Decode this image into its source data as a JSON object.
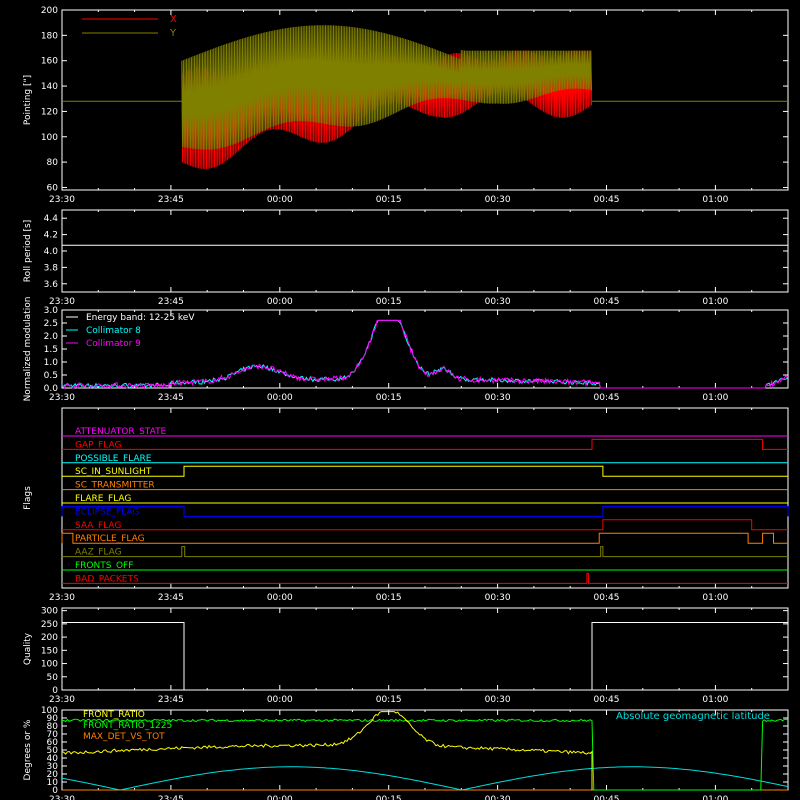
{
  "colors": {
    "background": "#000000",
    "axes": "#ffffff",
    "red": "#ff0000",
    "olive": "#808000",
    "cyan": "#00ffff",
    "magenta": "#ff00ff",
    "white": "#ffffff",
    "yellow": "#ffff00",
    "green": "#00ff00",
    "orange": "#ff8000",
    "blue": "#0000ff",
    "aqua": "#00ffdd"
  },
  "time_ticks": [
    "23:30",
    "23:45",
    "00:00",
    "00:15",
    "00:30",
    "00:45",
    "01:00"
  ],
  "chart_data": [
    {
      "type": "line",
      "name": "pointing",
      "ylabel": "Pointing [\"]",
      "ylim": [
        58,
        200
      ],
      "yticks": [
        "60",
        "80",
        "100",
        "120",
        "140",
        "160",
        "180",
        "200"
      ],
      "xlim_minutes_from_2330": [
        0,
        100
      ],
      "series": [
        {
          "name": "X",
          "color": "#ff0000",
          "t_start": 16.5,
          "t_end": 73,
          "min": 72,
          "max": 168,
          "outside_value": 128
        },
        {
          "name": "Y",
          "color": "#808000",
          "t_start": 16.5,
          "t_end": 73,
          "min": 92,
          "max": 188,
          "outside_value": 128
        }
      ],
      "legend": [
        "X",
        "Y"
      ]
    },
    {
      "type": "line",
      "name": "roll-period",
      "ylabel": "Roll period [s]",
      "ylim": [
        3.5,
        4.5
      ],
      "yticks": [
        "3.6",
        "3.8",
        "4.0",
        "4.2",
        "4.4"
      ],
      "series": [
        {
          "name": "Roll period",
          "color": "#ffffff",
          "value": 4.07
        }
      ]
    },
    {
      "type": "line",
      "name": "modulation",
      "ylabel": "Normalized modulation",
      "ylim": [
        0,
        3
      ],
      "yticks": [
        "0.0",
        "0.5",
        "1.0",
        "1.5",
        "2.0",
        "2.5",
        "3.0"
      ],
      "annotation": "Energy band: 12-25 keV",
      "legend": [
        "Collimator 8",
        "Collimator 9"
      ],
      "series": [
        {
          "name": "Collimator 8",
          "color": "#00ffff",
          "peak_time": 45,
          "peak_value": 2.6
        },
        {
          "name": "Collimator 9",
          "color": "#ff00ff",
          "peak_time": 45,
          "peak_value": 2.6
        }
      ]
    },
    {
      "type": "line",
      "name": "flags",
      "ylabel": "Flags",
      "flags": [
        {
          "label": "ATTENUATOR_STATE",
          "color": "#ff00ff",
          "high_intervals": []
        },
        {
          "label": "GAP_FLAG",
          "color": "#ff0000",
          "high_intervals": [
            [
              73,
              96.5
            ]
          ]
        },
        {
          "label": "POSSIBLE_FLARE",
          "color": "#00ffff",
          "high_intervals": []
        },
        {
          "label": "SC_IN_SUNLIGHT",
          "color": "#ffff00",
          "high_intervals": [
            [
              16.8,
              74.5
            ]
          ]
        },
        {
          "label": "SC_TRANSMITTER",
          "color": "#ff8000",
          "high_intervals": []
        },
        {
          "label": "FLARE_FLAG",
          "color": "#ffff00",
          "high_intervals": []
        },
        {
          "label": "ECLIPSE_FLAG",
          "color": "#0000ff",
          "high_intervals": [
            [
              0,
              16.8
            ],
            [
              74.5,
              100
            ]
          ]
        },
        {
          "label": "SAA_FLAG",
          "color": "#ff0000",
          "high_intervals": [
            [
              74.5,
              95
            ]
          ]
        },
        {
          "label": "PARTICLE_FLAG",
          "color": "#ff8000",
          "high_intervals": [
            [
              0,
              1.5
            ],
            [
              74,
              94.5
            ],
            [
              96.5,
              98
            ]
          ]
        },
        {
          "label": "AAZ_FLAG",
          "color": "#808000",
          "high_intervals": [
            [
              16.5,
              16.9
            ],
            [
              74.2,
              74.5
            ]
          ]
        },
        {
          "label": "FRONTS_OFF",
          "color": "#00ff00",
          "high_intervals": []
        },
        {
          "label": "BAD_PACKETS",
          "color": "#ff0000",
          "high_intervals": [
            [
              72.3,
              72.5
            ]
          ]
        }
      ]
    },
    {
      "type": "line",
      "name": "quality",
      "ylabel": "Quality",
      "ylim": [
        0,
        310
      ],
      "yticks": [
        "0",
        "50",
        "100",
        "150",
        "200",
        "250",
        "300"
      ],
      "series": [
        {
          "name": "Quality",
          "color": "#ffffff",
          "high_value": 255,
          "high_intervals": [
            [
              0,
              16.8
            ],
            [
              73,
              100
            ]
          ]
        }
      ]
    },
    {
      "type": "line",
      "name": "ratios",
      "ylabel": "Degrees or %",
      "ylim": [
        0,
        100
      ],
      "yticks": [
        "0",
        "10",
        "20",
        "30",
        "40",
        "50",
        "60",
        "70",
        "80",
        "90",
        "100"
      ],
      "legend": [
        "FRONT_RATIO",
        "FRONT_RATIO_1225",
        "MAX_DET_VS_TOT"
      ],
      "annotation": "Absolute geomagnetic latitude",
      "series": [
        {
          "name": "FRONT_RATIO",
          "color": "#ffff00",
          "base_value": 48,
          "peak_value": 95
        },
        {
          "name": "FRONT_RATIO_1225",
          "color": "#00ff00",
          "base_value": 87,
          "dropout_value": 0
        },
        {
          "name": "MAX_DET_VS_TOT",
          "color": "#ff8000",
          "value": 0
        },
        {
          "name": "Absolute geomagnetic latitude",
          "color": "#00dddd",
          "max_value": 29
        }
      ]
    }
  ]
}
